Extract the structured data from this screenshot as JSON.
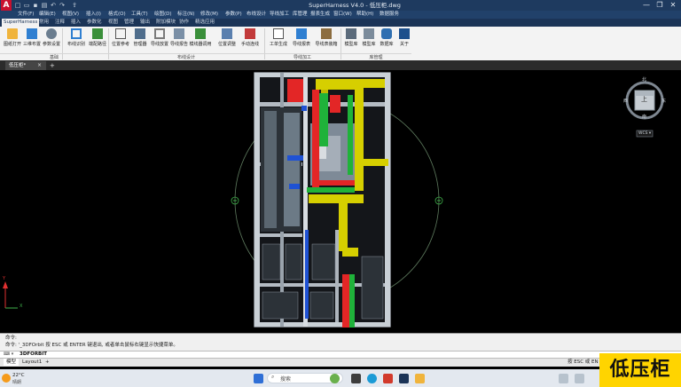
{
  "titlebar": {
    "logo": "A",
    "title": "SuperHarness V4.0 - 低压柜.dwg",
    "qat_icons": [
      "new-icon",
      "open-icon",
      "save-icon",
      "print-icon",
      "undo-icon",
      "redo-icon",
      "share-icon"
    ],
    "controls": [
      "—",
      "❐",
      "✕"
    ]
  },
  "menubar": {
    "items": [
      "文件(F)",
      "编辑(E)",
      "视图(V)",
      "插入(I)",
      "格式(O)",
      "工具(T)",
      "绘图(D)",
      "标注(N)",
      "修改(M)",
      "参数(P)",
      "布线设计",
      "导线加工",
      "库管理",
      "报表生成",
      "窗口(W)",
      "帮助(H)",
      "数据服务"
    ]
  },
  "ribbon_tabs": {
    "items": [
      "SuperHarness",
      "常用",
      "注释",
      "插入",
      "参数化",
      "视图",
      "管理",
      "输出",
      "附加模块",
      "协作",
      "精选应用"
    ],
    "active": 0
  },
  "ribbon": {
    "buttons": [
      "图纸打开",
      "三维布置",
      "参数设置",
      "布线识别",
      "端配路径",
      "位置参考",
      "管理器",
      "导线放置",
      "导线报告",
      "模线器调用",
      "位置调整",
      "手动连线",
      "工单生成",
      "导线报表",
      "导线表装箱",
      "模型库",
      "模型库",
      "数据库",
      "关于"
    ],
    "groups": [
      "基础",
      "布线设计",
      "导线加工",
      "库管理"
    ]
  },
  "document": {
    "tab": "低压柜*",
    "close": "×",
    "add": "+"
  },
  "viewcube": {
    "top_label": "上",
    "north": "北",
    "south": "南",
    "east": "东",
    "west": "西",
    "wcs": "WCS ▾"
  },
  "ucs": {
    "x": "X",
    "y": "Y"
  },
  "command": {
    "history_1": "命令:",
    "history_2": "命令: '_3DFOrbit 按 ESC 或 ENTER 键退出, 或者单击鼠标右键显示快捷菜单。",
    "input": "3DFORBIT",
    "prompt": "⌨ ▾"
  },
  "layouts": {
    "tabs": [
      "模型",
      "Layout1",
      "+"
    ],
    "status": "按 ESC 或 EN"
  },
  "taskbar": {
    "temp": "22°C",
    "weather": "晴朗",
    "search_placeholder": "搜索",
    "time": ""
  },
  "overlay_badge": "低压柜",
  "colors": {
    "titlebar": "#1e3a5f",
    "accent": "#ffd400",
    "red": "#e32626",
    "green": "#1fb23a",
    "yellow": "#d9d400",
    "blue": "#1f52d4"
  }
}
